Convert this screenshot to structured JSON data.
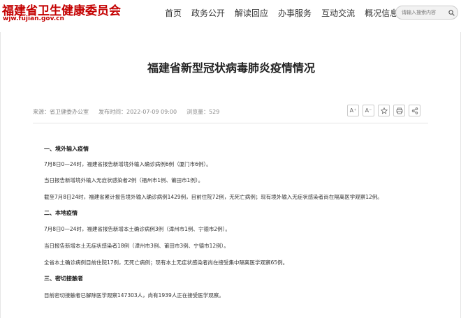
{
  "header": {
    "logo_text": "福建省卫生健康委员会",
    "logo_url": "wjw.fujian.gov.cn",
    "nav": [
      "首页",
      "政务公开",
      "解读回应",
      "办事服务",
      "互动交流",
      "概况信息"
    ],
    "search_placeholder": "请输入搜索内容"
  },
  "article": {
    "title": "福建省新型冠状病毒肺炎疫情情况",
    "source": "来源：省卫健委办公室",
    "published": "发布时间：2022-07-09 09:00",
    "views": "浏览量：529",
    "tools": {
      "font_increase": "A⁺",
      "font_decrease": "A⁻",
      "favorite_icon": "star-icon",
      "print_icon": "print-icon",
      "share_icon": "share-icon"
    },
    "sections": [
      {
        "heading": "一、境外输入疫情",
        "paragraphs": [
          "7月8日0—24时，福建省报告新增境外输入确诊病例6例（厦门市6例）。",
          "当日报告新增境外输入无症状感染者2例（福州市1例、莆田市1例）。",
          "截至7月8日24时，福建省累计报告境外输入确诊病例1429例，目前住院72例，无死亡病例；现有境外输入无症状感染者尚在隔离医学观察12例。"
        ]
      },
      {
        "heading": "二、本地疫情",
        "paragraphs": [
          "7月8日0—24时，福建省报告新增本土确诊病例3例（漳州市1例、宁德市2例）。",
          "当日报告新增本土无症状感染者18例（漳州市3例、莆田市3例、宁德市12例）。",
          "全省本土确诊病例目前住院17例，无死亡病例；现有本土无症状感染者尚在接受集中隔离医学观察65例。"
        ]
      },
      {
        "heading": "三、密切接触者",
        "paragraphs": [
          "目前密切接触者已解除医学观察147303人，尚有1939人正在接受医学观察。"
        ]
      }
    ]
  }
}
